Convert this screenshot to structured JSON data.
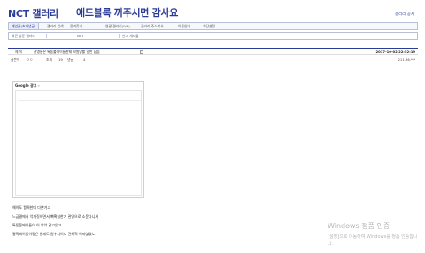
{
  "header": {
    "gallery_title": "NCT 갤러리",
    "ad_banner": "애드블록 꺼주시면 감사요",
    "gallery_notice": "갤러리 공지"
  },
  "tabs": [
    {
      "label": "개념글(초개념글)"
    },
    {
      "label": "갤러리 검색"
    },
    {
      "label": "즐겨찾기"
    },
    {
      "label": "연관 갤러리(0/3)"
    },
    {
      "label": "갤러리 주소복사"
    },
    {
      "label": "이용안내"
    },
    {
      "label": "차단설정"
    }
  ],
  "sub_bar": {
    "recent": "최근 방문 갤러리",
    "current": "NCT",
    "new_gallery": "신고 게시물"
  },
  "post": {
    "title_label": "제 목",
    "title": "관영들은 톡동불에이들한테 학원당할 일만 남음",
    "date": "2017-10-02 22:52:19",
    "author_label": "글쓴이",
    "author": "ㅇㅇ",
    "views_label": "조회",
    "views": "19",
    "comments_label": "댓글",
    "comments": "4",
    "ip": "211.36.*.*"
  },
  "ad": {
    "label": "Google 광고",
    "arrow": "»"
  },
  "body_lines": [
    "해이도 꿩찍한데 다뿐거고",
    "느금결에서 악개짓하면서 뼈확칭한거 관영으로 소문다니서",
    "톡동불에이들이 이 악악 갈고있고",
    "꿩찍에이들이랑은 원래도 원수사이니 관해혁 어지않았노"
  ],
  "watermark": {
    "title": "Windows 정품 인증",
    "line1": "[설정]으로 이동하여 Windows를 정품 인증합니",
    "line2": "다."
  }
}
